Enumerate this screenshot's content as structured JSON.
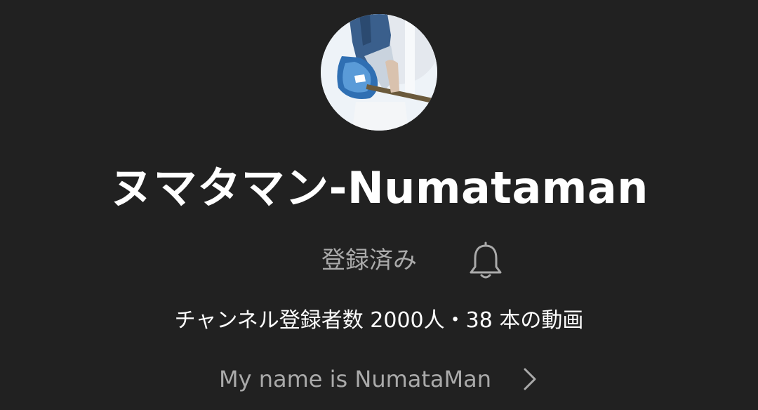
{
  "channel": {
    "avatar_icon": "channel-avatar-guitarist",
    "name": "ヌマタマン-Numataman",
    "subscribe_status": "登録済み",
    "notification_icon": "bell-icon",
    "stats": "チャンネル登録者数 2000人・38 本の動画",
    "description": "My name is NumataMan",
    "description_icon": "chevron-right-icon"
  },
  "colors": {
    "background": "#212121",
    "primary_text": "#ffffff",
    "secondary_text": "#aaaaaa"
  }
}
